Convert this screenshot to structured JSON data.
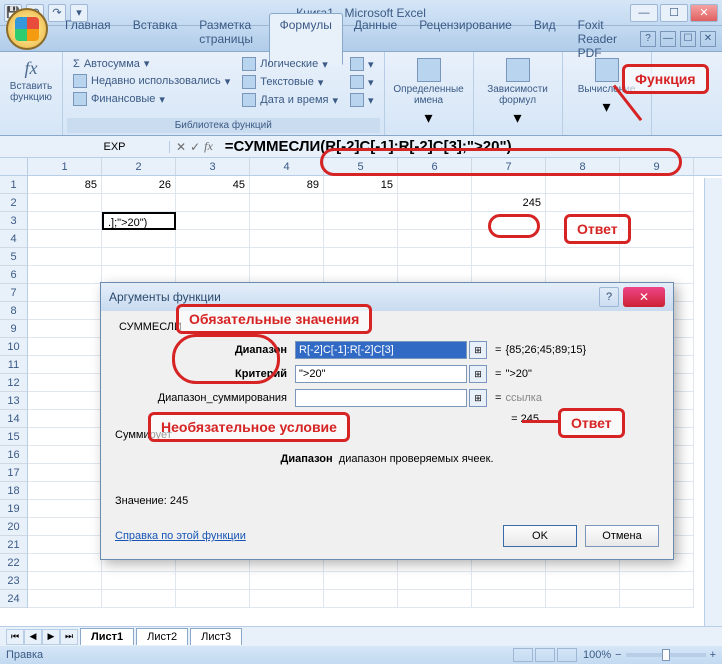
{
  "title": "Книга1 - Microsoft Excel",
  "tabs": [
    "Главная",
    "Вставка",
    "Разметка страницы",
    "Формулы",
    "Данные",
    "Рецензирование",
    "Вид",
    "Foxit Reader PDF"
  ],
  "active_tab_index": 3,
  "ribbon": {
    "insert_fn": "Вставить функцию",
    "library_group": "Библиотека функций",
    "lib_items": [
      "Автосумма",
      "Недавно использовались",
      "Финансовые",
      "Логические",
      "Текстовые",
      "Дата и время"
    ],
    "defined_names": "Определенные имена",
    "formula_audit": "Зависимости формул",
    "calculation": "Вычисление"
  },
  "name_box": "EXP",
  "formula": "=СУММЕСЛИ(R[-2]C[-1]:R[-2]C[3];\">20\")",
  "columns": [
    "1",
    "2",
    "3",
    "4",
    "5",
    "6",
    "7",
    "8",
    "9"
  ],
  "rows": {
    "1": [
      "85",
      "26",
      "45",
      "89",
      "15",
      "",
      "",
      "",
      ""
    ],
    "2": [
      "",
      "",
      "",
      "",
      "",
      "",
      "245",
      "",
      ""
    ],
    "3": [
      "",
      ".];\">20\")",
      "",
      "",
      "",
      "",
      "",
      "",
      ""
    ]
  },
  "row_count": 24,
  "annotations": {
    "function": "Функция",
    "answer": "Ответ",
    "required": "Обязательные значения",
    "optional": "Необязательное условие"
  },
  "dialog": {
    "title": "Аргументы функции",
    "fn_name": "СУММЕСЛИ",
    "args": {
      "range_label": "Диапазон",
      "range_value": "R[-2]C[-1]:R[-2]C[3]",
      "range_eval": "{85;26;45;89;15}",
      "criteria_label": "Критерий",
      "criteria_value": "\">20\"",
      "criteria_eval": "\">20\"",
      "sum_range_label": "Диапазон_суммирования",
      "sum_range_value": "",
      "sum_range_eval": "ссылка"
    },
    "result_eq": "= ",
    "result_value": "245",
    "summary_prefix": "Суммирует",
    "desc_bold": "Диапазон",
    "desc_rest": "диапазон проверяемых ячеек.",
    "value_label": "Значение:",
    "value": "245",
    "help_link": "Справка по этой функции",
    "ok": "OK",
    "cancel": "Отмена"
  },
  "sheet_tabs": [
    "Лист1",
    "Лист2",
    "Лист3"
  ],
  "status": "Правка",
  "zoom": "100%",
  "help_icon": "?"
}
